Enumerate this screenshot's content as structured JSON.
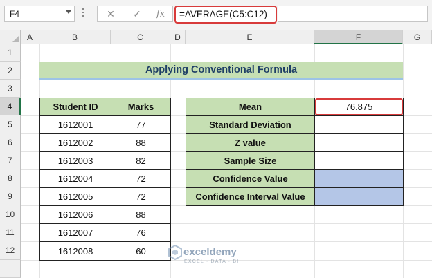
{
  "formula_bar": {
    "name_box": "F4",
    "cancel_icon": "✕",
    "enter_icon": "✓",
    "fx_icon": "fx",
    "formula": "=AVERAGE(C5:C12)"
  },
  "columns": [
    "A",
    "B",
    "C",
    "D",
    "E",
    "F",
    "G"
  ],
  "rows": [
    "1",
    "2",
    "3",
    "4",
    "5",
    "6",
    "7",
    "8",
    "9",
    "10",
    "11",
    "12"
  ],
  "selected_cell": {
    "column": "F",
    "row": "4"
  },
  "title": "Applying Conventional Formula",
  "marks_table": {
    "headers": [
      "Student ID",
      "Marks"
    ],
    "rows": [
      [
        "1612001",
        "77"
      ],
      [
        "1612002",
        "88"
      ],
      [
        "1612003",
        "82"
      ],
      [
        "1612004",
        "72"
      ],
      [
        "1612005",
        "72"
      ],
      [
        "1612006",
        "88"
      ],
      [
        "1612007",
        "76"
      ],
      [
        "1612008",
        "60"
      ]
    ]
  },
  "stats_table": {
    "rows": [
      {
        "label": "Mean",
        "value": "76.875"
      },
      {
        "label": "Standard Deviation",
        "value": ""
      },
      {
        "label": "Z value",
        "value": ""
      },
      {
        "label": "Sample Size",
        "value": ""
      },
      {
        "label": "Confidence Value",
        "value": ""
      },
      {
        "label": "Confidence Interval Value",
        "value": ""
      }
    ]
  },
  "watermark": {
    "name": "exceldemy",
    "tagline": "EXCEL · DATA · BI"
  },
  "colors": {
    "header_green": "#c6dfb3",
    "title_text": "#1f3f66",
    "blue_fill": "#b4c6e7",
    "highlight_red": "#d83b3b",
    "excel_green": "#217346"
  }
}
